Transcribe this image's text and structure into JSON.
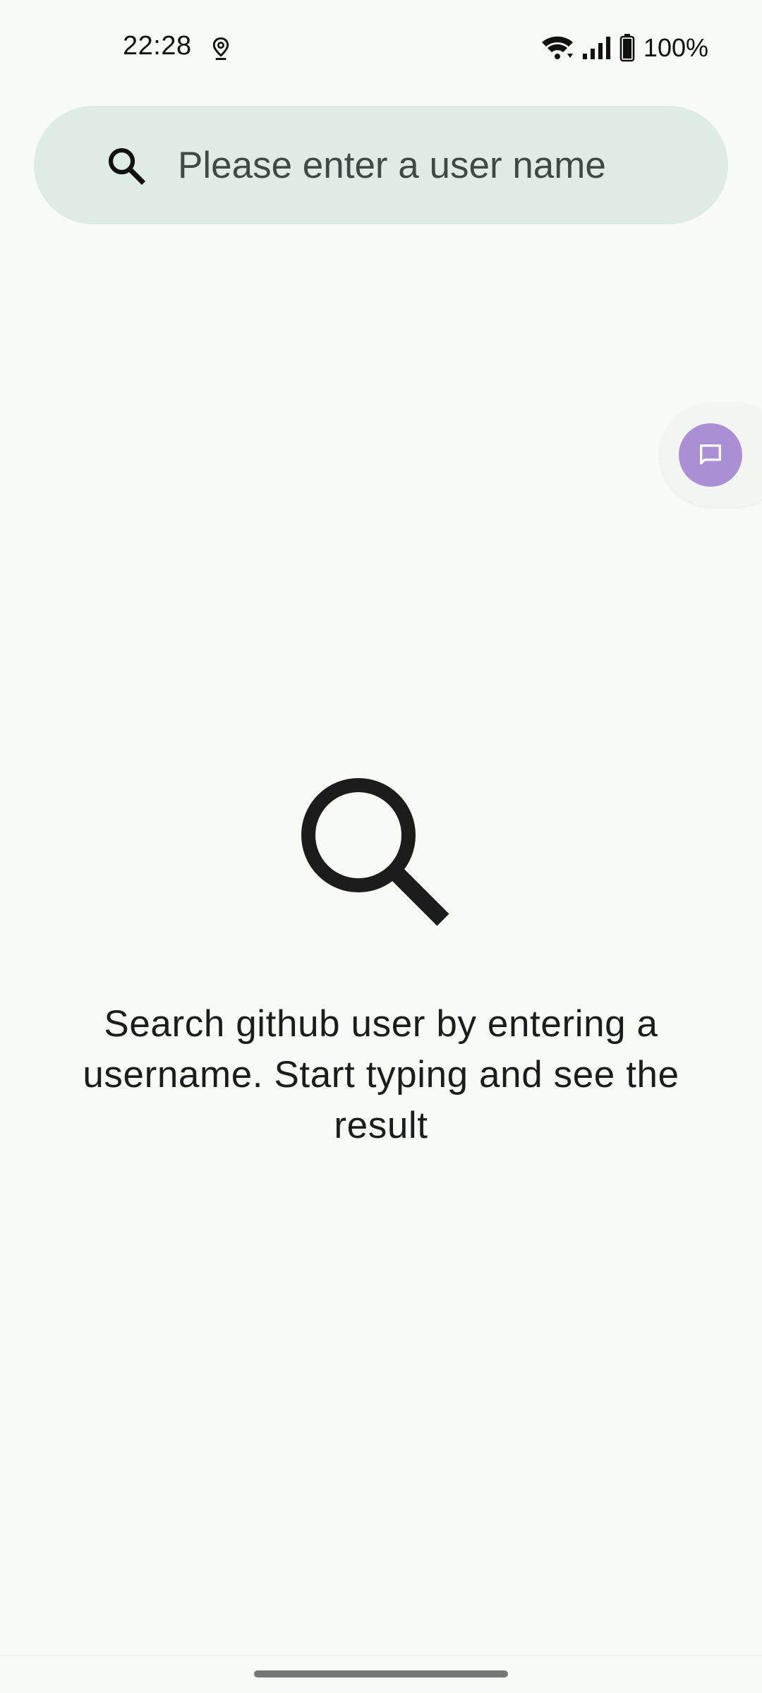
{
  "status_bar": {
    "time": "22:28",
    "location_icon": "location-pin-icon",
    "wifi_icon": "wifi-icon",
    "signal_icon": "cell-signal-icon",
    "battery_icon": "battery-icon",
    "battery_text": "100%"
  },
  "search": {
    "icon": "search-icon",
    "placeholder": "Please enter a user name",
    "value": ""
  },
  "chat_bubble": {
    "icon": "chat-bubble-icon",
    "color": "#ab8fd4"
  },
  "empty_state": {
    "icon": "magnifier-icon",
    "message": "Search github user by entering a username. Start typing and see the result"
  },
  "colors": {
    "background": "#f8faf5",
    "search_bar": "#dfece6",
    "text": "#1b1c1b"
  }
}
